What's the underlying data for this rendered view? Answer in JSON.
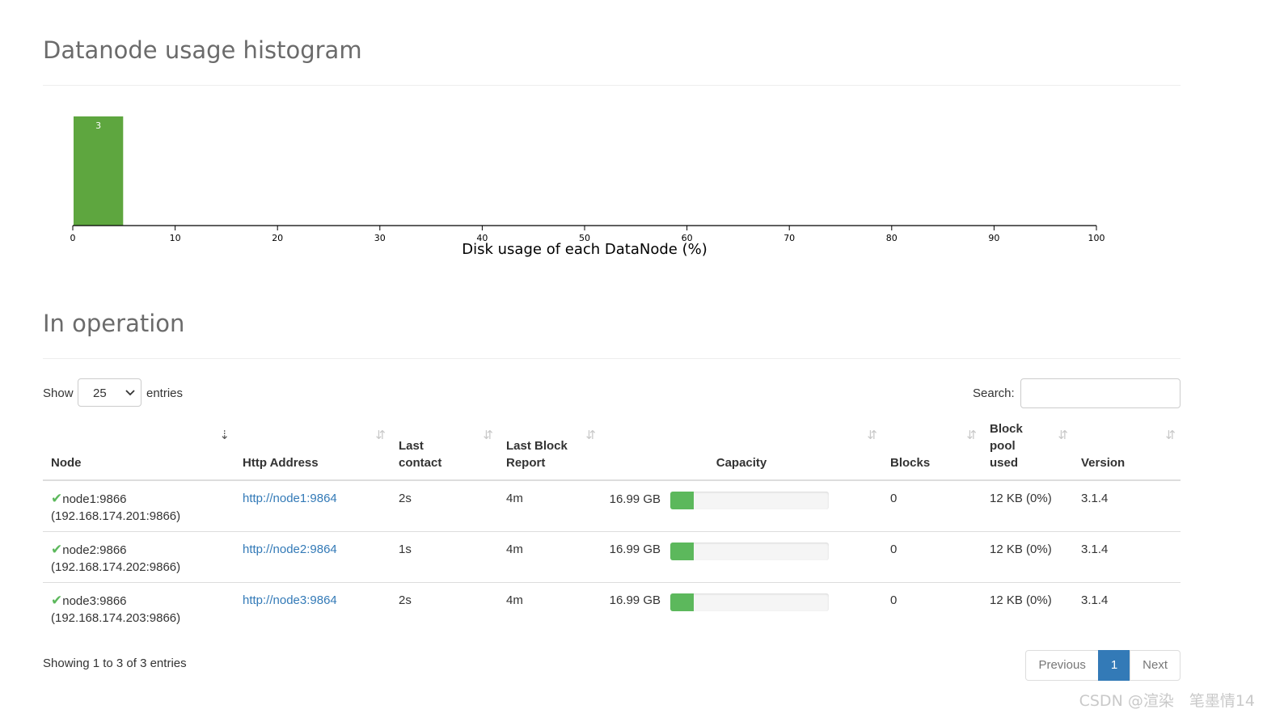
{
  "histogram": {
    "title": "Datanode usage histogram",
    "chart_data": {
      "type": "bar",
      "xlabel": "Disk usage of each DataNode (%)",
      "xlim": [
        0,
        100
      ],
      "ticks": [
        "0",
        "10",
        "20",
        "30",
        "40",
        "50",
        "60",
        "70",
        "80",
        "90",
        "100"
      ],
      "bins": [
        {
          "from": 0,
          "to": 5,
          "count": 3
        }
      ],
      "bar_color": "#5ea63f"
    }
  },
  "operation": {
    "title": "In operation",
    "show_label": "Show",
    "entries_label": "entries",
    "page_size": "25",
    "search_label": "Search:",
    "search_value": "",
    "columns": [
      "Node",
      "Http Address",
      "Last contact",
      "Last Block Report",
      "Capacity",
      "Blocks",
      "Block pool used",
      "Version"
    ],
    "rows": [
      {
        "node": "node1:9866",
        "ip": "(192.168.174.201:9866)",
        "http": "http://node1:9864",
        "last_contact": "2s",
        "last_block_report": "4m",
        "capacity": "16.99 GB",
        "used_pct": 15,
        "blocks": "0",
        "pool_used": "12 KB (0%)",
        "version": "3.1.4"
      },
      {
        "node": "node2:9866",
        "ip": "(192.168.174.202:9866)",
        "http": "http://node2:9864",
        "last_contact": "1s",
        "last_block_report": "4m",
        "capacity": "16.99 GB",
        "used_pct": 15,
        "blocks": "0",
        "pool_used": "12 KB (0%)",
        "version": "3.1.4"
      },
      {
        "node": "node3:9866",
        "ip": "(192.168.174.203:9866)",
        "http": "http://node3:9864",
        "last_contact": "2s",
        "last_block_report": "4m",
        "capacity": "16.99 GB",
        "used_pct": 15,
        "blocks": "0",
        "pool_used": "12 KB (0%)",
        "version": "3.1.4"
      }
    ],
    "info": "Showing 1 to 3 of 3 entries",
    "pagination": {
      "previous": "Previous",
      "current": "1",
      "next": "Next"
    },
    "colors": {
      "accent": "#337ab7",
      "success": "#5cb85c"
    }
  },
  "watermark": "CSDN @渲染　笔墨情14"
}
